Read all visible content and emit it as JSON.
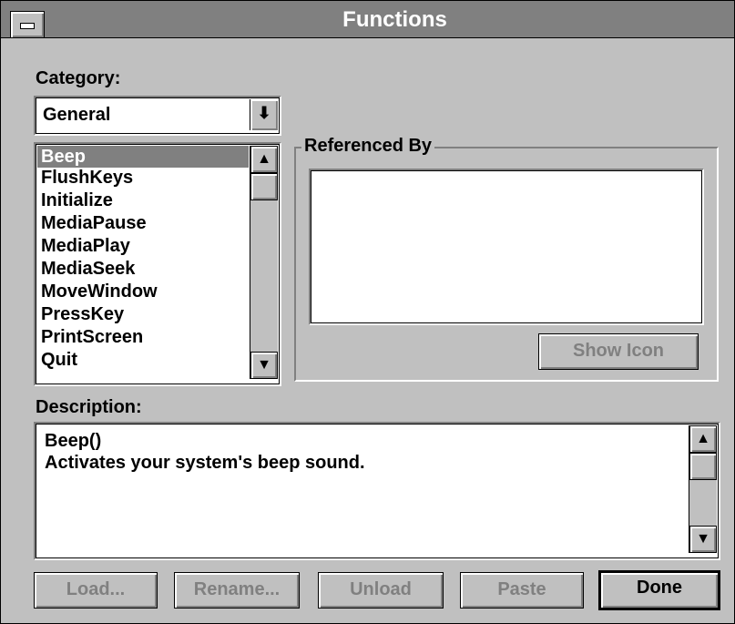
{
  "window": {
    "title": "Functions"
  },
  "category": {
    "label": "Category:",
    "selected": "General"
  },
  "functions_list": {
    "items": [
      "Beep",
      "FlushKeys",
      "Initialize",
      "MediaPause",
      "MediaPlay",
      "MediaSeek",
      "MoveWindow",
      "PressKey",
      "PrintScreen",
      "Quit"
    ],
    "selected_index": 0
  },
  "referenced_by": {
    "label": "Referenced By",
    "show_icon_label": "Show Icon"
  },
  "description": {
    "label": "Description:",
    "lines": [
      "Beep()",
      "Activates your system's beep sound."
    ]
  },
  "buttons": {
    "load": "Load...",
    "rename": "Rename...",
    "unload": "Unload",
    "paste": "Paste",
    "done": "Done"
  }
}
